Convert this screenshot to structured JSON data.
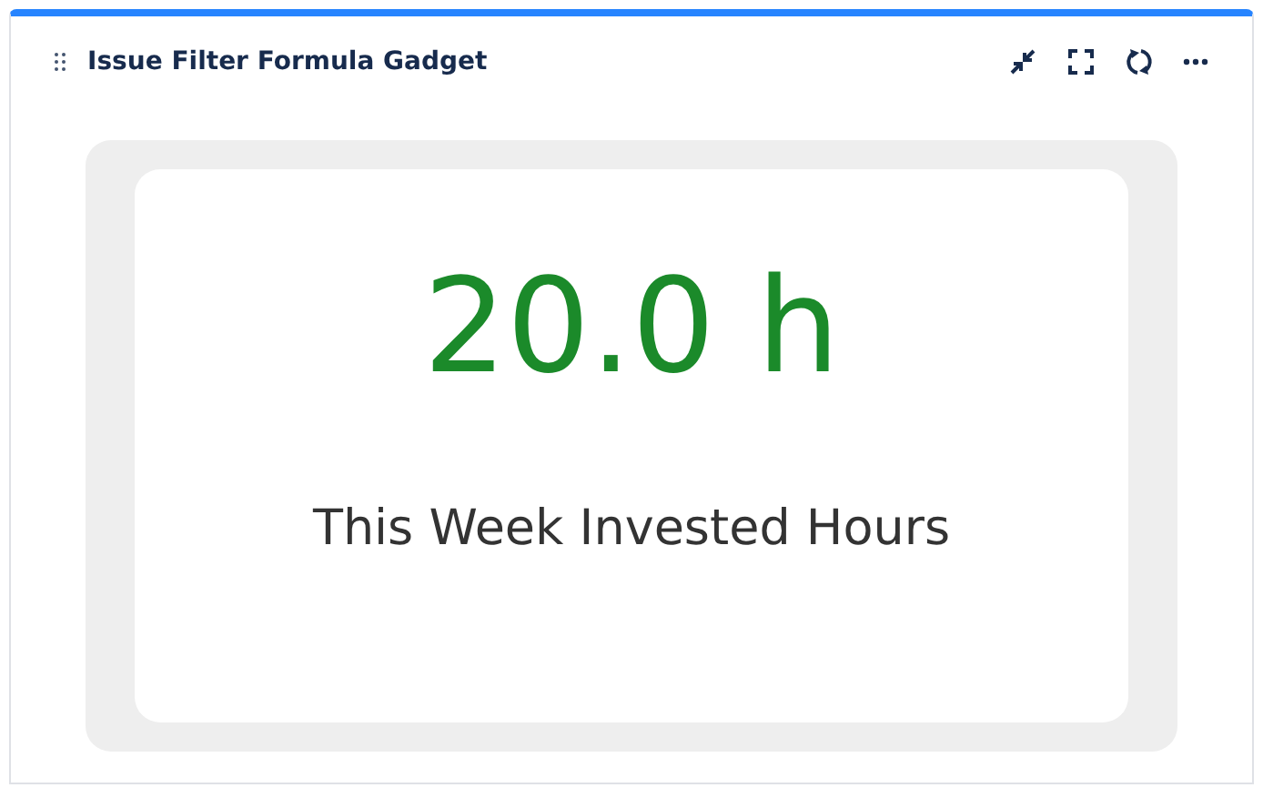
{
  "gadget": {
    "title": "Issue Filter Formula Gadget"
  },
  "metric": {
    "value": "20.0 h",
    "label": "This Week Invested Hours"
  }
}
